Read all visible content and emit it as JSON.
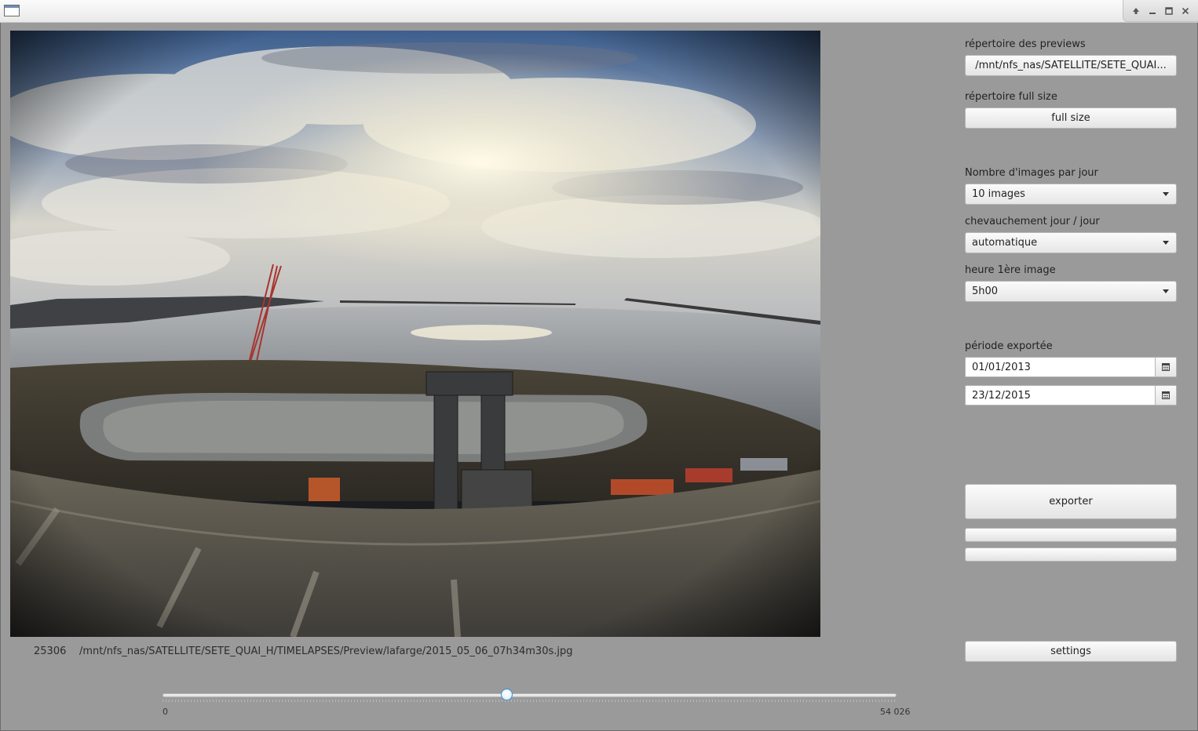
{
  "window": {
    "controls": [
      "up-icon",
      "minimize-icon",
      "maximize-icon",
      "close-icon"
    ]
  },
  "viewer": {
    "index": "25306",
    "file_path": "/mnt/nfs_nas/SATELLITE/SETE_QUAI_H/TIMELAPSES/Preview/lafarge/2015_05_06_07h34m30s.jpg"
  },
  "slider": {
    "min_label": "0",
    "max_label": "54 026",
    "min": 0,
    "max": 54026,
    "value": 25306
  },
  "panel": {
    "previews_label": "répertoire des previews",
    "previews_button": "/mnt/nfs_nas/SATELLITE/SETE_QUAI...",
    "fullsize_label": "répertoire full size",
    "fullsize_button": "full size",
    "images_per_day_label": "Nombre d'images par jour",
    "images_per_day_value": "10 images",
    "overlap_label": "chevauchement jour / jour",
    "overlap_value": "automatique",
    "first_image_label": "heure 1ère image",
    "first_image_value": "5h00",
    "period_label": "période exportée",
    "period_start": "01/01/2013",
    "period_end": "23/12/2015",
    "export_button": "exporter",
    "settings_button": "settings"
  }
}
